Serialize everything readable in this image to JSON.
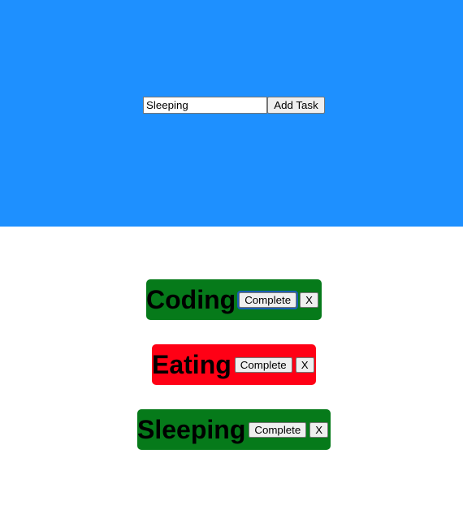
{
  "form": {
    "input_value": "Sleeping",
    "add_label": "Add Task"
  },
  "tasks": [
    {
      "title": "Coding",
      "complete_label": "Complete",
      "remove_label": "X",
      "color": "#067a1a",
      "status": "complete"
    },
    {
      "title": "Eating",
      "complete_label": "Complete",
      "remove_label": "X",
      "color": "#ff0015",
      "status": "incomplete"
    },
    {
      "title": "Sleeping",
      "complete_label": "Complete",
      "remove_label": "X",
      "color": "#067a1a",
      "status": "complete"
    }
  ],
  "colors": {
    "header_bg": "#1e90ff",
    "complete_task": "#067a1a",
    "incomplete_task": "#ff0015"
  }
}
